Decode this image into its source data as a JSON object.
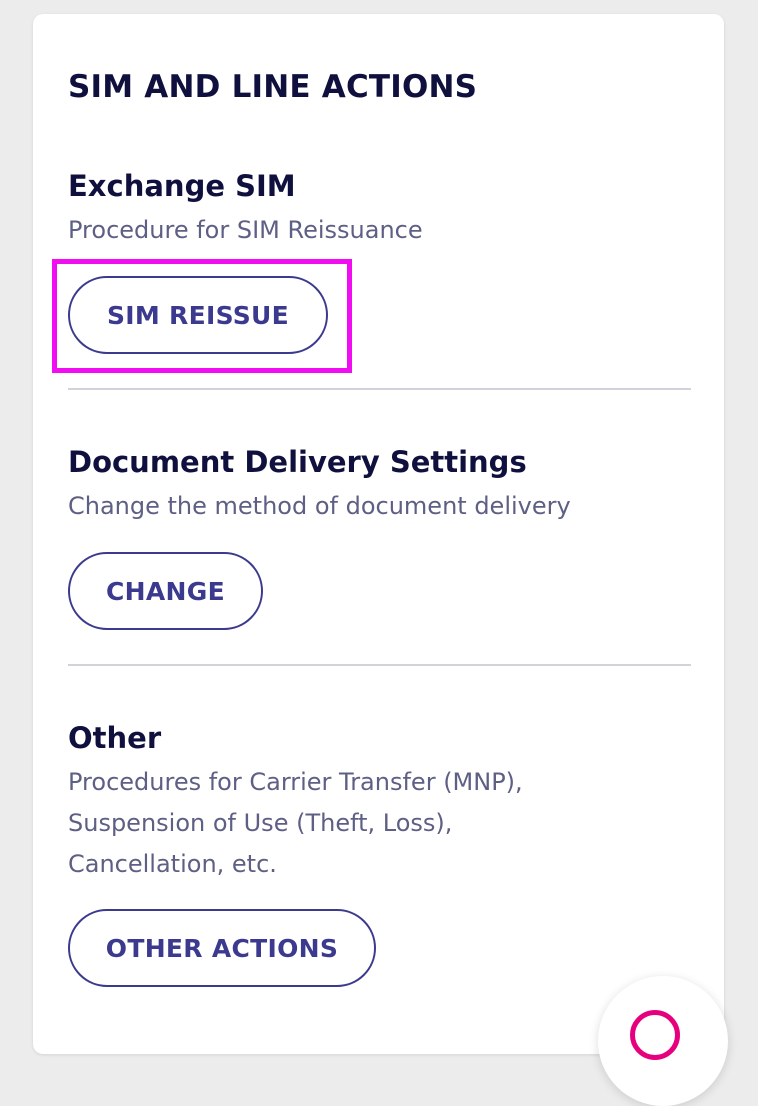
{
  "card": {
    "title": "SIM AND LINE ACTIONS"
  },
  "sections": [
    {
      "title": "Exchange SIM",
      "description": "Procedure for SIM Reissuance",
      "button_label": "SIM REISSUE"
    },
    {
      "title": "Document Delivery Settings",
      "description": "Change the method of document delivery",
      "button_label": "CHANGE"
    },
    {
      "title": "Other",
      "description_lines": [
        "Procedures for Carrier Transfer (MNP),",
        "Suspension of Use (Theft, Loss),",
        "Cancellation, etc."
      ],
      "button_label": "OTHER ACTIONS"
    }
  ],
  "colors": {
    "title_text": "#10103e",
    "description_text": "#5e5f84",
    "button_accent": "#3c3a8e",
    "highlight": "#f20cf2",
    "fab_accent": "#e6007e"
  },
  "icons": {
    "fab": "chat-icon"
  }
}
